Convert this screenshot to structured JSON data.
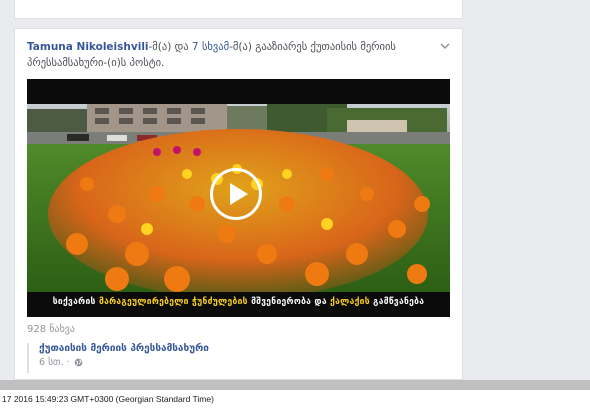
{
  "post": {
    "author": "Tamuna Nikoleishvili",
    "text_mid": "-მ(ა) და ",
    "link_count": "7 სხვამ",
    "text_end": "-მ(ა) გააზიარეს ქუთაისის მერიის პრესსამსახური-(ი)ს პოსტი."
  },
  "video": {
    "caption_white1": "სიქვარის ",
    "caption_yellow1": "მარაგეულირებელი ჭუნძულების",
    "caption_white2": " მშვენიერობა და ",
    "caption_yellow2": "ქალაქის",
    "caption_white3": " გამწვანება"
  },
  "views": "928 ნახვა",
  "shared_source": {
    "page_name": "ქუთაისის მერიის პრესსამსახური",
    "time": "6 სთ. ·"
  },
  "footer": {
    "timestamp": "17 2016 15:49:23 GMT+0300 (Georgian Standard Time)"
  }
}
